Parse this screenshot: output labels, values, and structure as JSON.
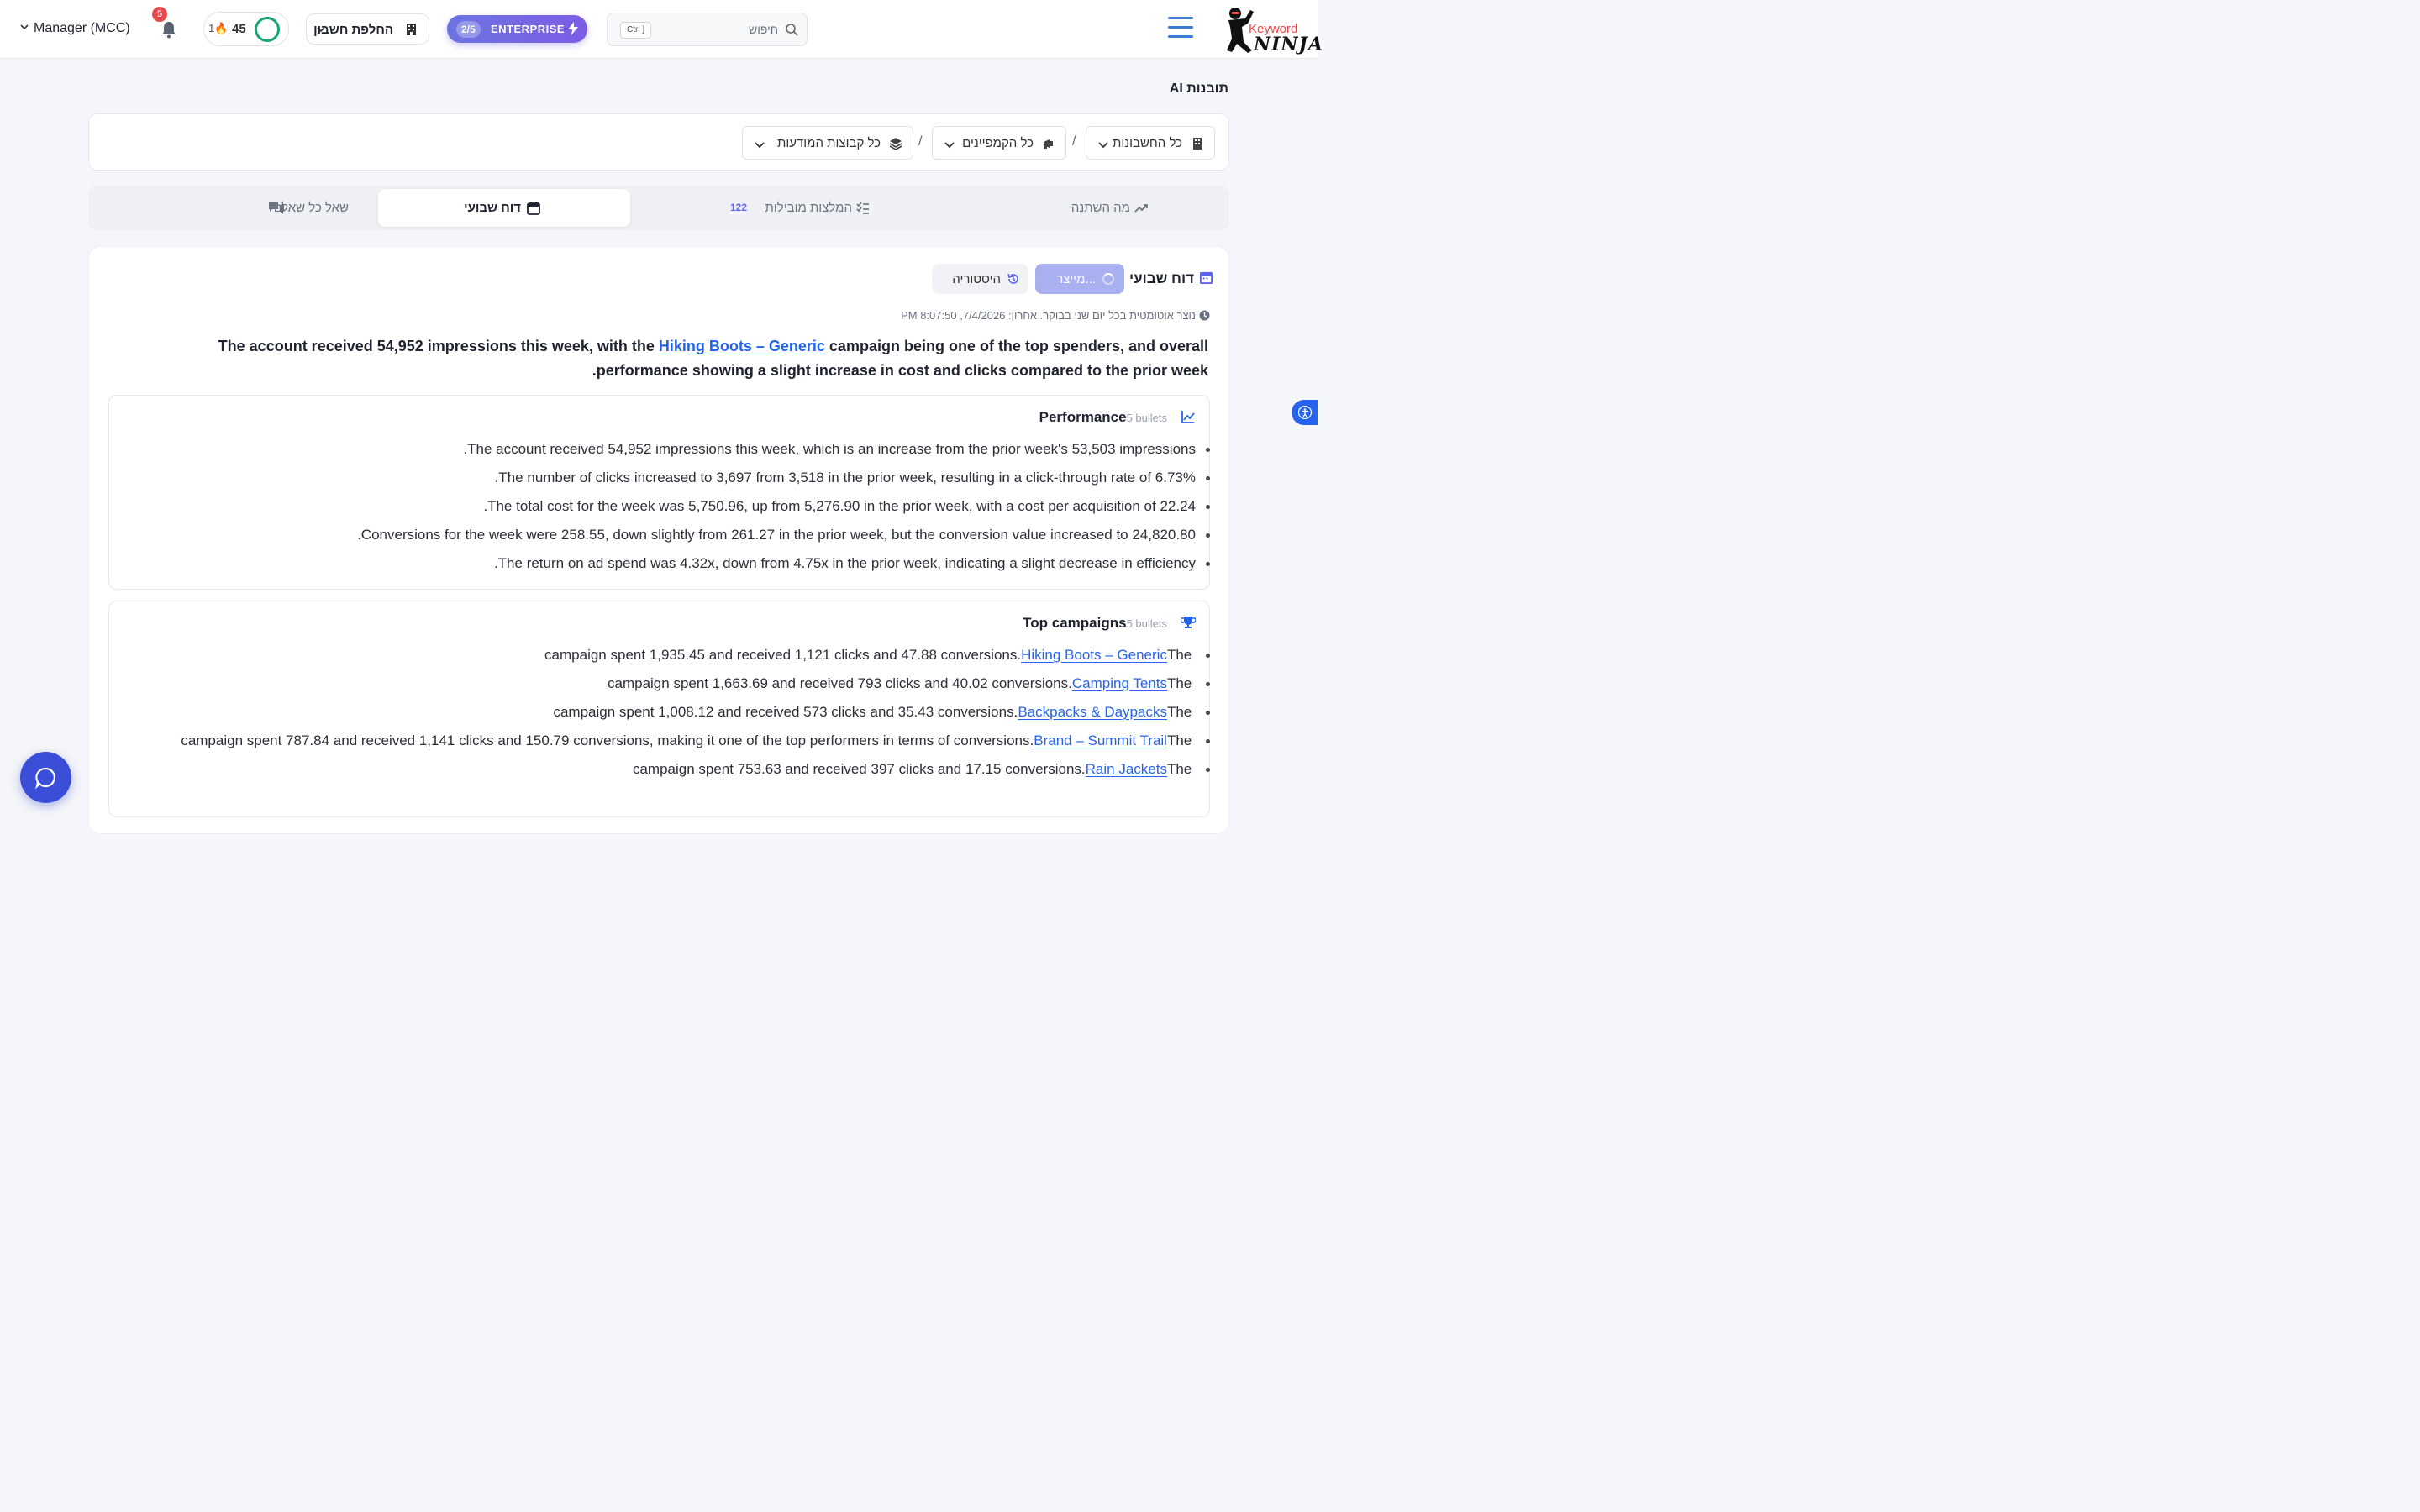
{
  "header": {
    "logo_small": "Keyword",
    "logo_big": "NINJA",
    "search_placeholder": "חיפוש",
    "search_shortcut": "Ctrl ]",
    "plan_count": "2/5",
    "plan_label": "ENTERPRISE",
    "switch_account": "החלפת חשבון",
    "score": "45",
    "streak": "1",
    "notifications": "5",
    "account_mode": "Manager (MCC)"
  },
  "page_title": "תובנות AI",
  "filters": {
    "accounts": "כל החשבונות",
    "campaigns": "כל הקמפיינים",
    "adgroups": "כל קבוצות המודעות",
    "separator": "/"
  },
  "tabs": [
    {
      "label": "מה השתנה",
      "count": ""
    },
    {
      "label": "המלצות מובילות",
      "count": "122"
    },
    {
      "label": "דוח שבועי",
      "count": ""
    },
    {
      "label": "שאל כל שאלה",
      "count": ""
    }
  ],
  "report": {
    "title": "דוח שבועי",
    "generating": "מייצר...",
    "history": "היסטוריה",
    "meta": "נוצר אוטומטית בכל יום שני בבוקר. אחרון: 7/4/2026, 8:07:50 PM",
    "summary_pre": "The account received 54,952 impressions this week, with the ",
    "summary_link": "Hiking Boots – Generic",
    "summary_post": " campaign being one of the top spenders, and overall performance showing a slight increase in cost and clicks compared to the prior week."
  },
  "performance": {
    "title": "Performance",
    "count": "5 bullets",
    "bullets": [
      "The account received 54,952 impressions this week, which is an increase from the prior week's 53,503 impressions.",
      "The number of clicks increased to 3,697 from 3,518 in the prior week, resulting in a click-through rate of 6.73%.",
      "The total cost for the week was 5,750.96, up from 5,276.90 in the prior week, with a cost per acquisition of 22.24.",
      "Conversions for the week were 258.55, down slightly from 261.27 in the prior week, but the conversion value increased to 24,820.80.",
      "The return on ad spend was 4.32x, down from 4.75x in the prior week, indicating a slight decrease in efficiency."
    ]
  },
  "top_campaigns": {
    "title": "Top campaigns",
    "count": "5 bullets",
    "prefix": "The ",
    "items": [
      {
        "name": "Hiking Boots – Generic",
        "text": " campaign spent 1,935.45 and received 1,121 clicks and 47.88 conversions."
      },
      {
        "name": "Camping Tents",
        "text": " campaign spent 1,663.69 and received 793 clicks and 40.02 conversions."
      },
      {
        "name": "Backpacks & Daypacks",
        "text": " campaign spent 1,008.12 and received 573 clicks and 35.43 conversions."
      },
      {
        "name": "Brand – Summit Trail",
        "text": " campaign spent 787.84 and received 1,141 clicks and 150.79 conversions, making it one of the top performers in terms of conversions."
      },
      {
        "name": "Rain Jackets",
        "text": " campaign spent 753.63 and received 397 clicks and 17.15 conversions."
      }
    ]
  },
  "colors": {
    "accent": "#2563eb",
    "enterprise_from": "#6c74e0",
    "enterprise_to": "#7d5ce6",
    "badge": "#e5484d",
    "score_ring": "#17a673"
  }
}
